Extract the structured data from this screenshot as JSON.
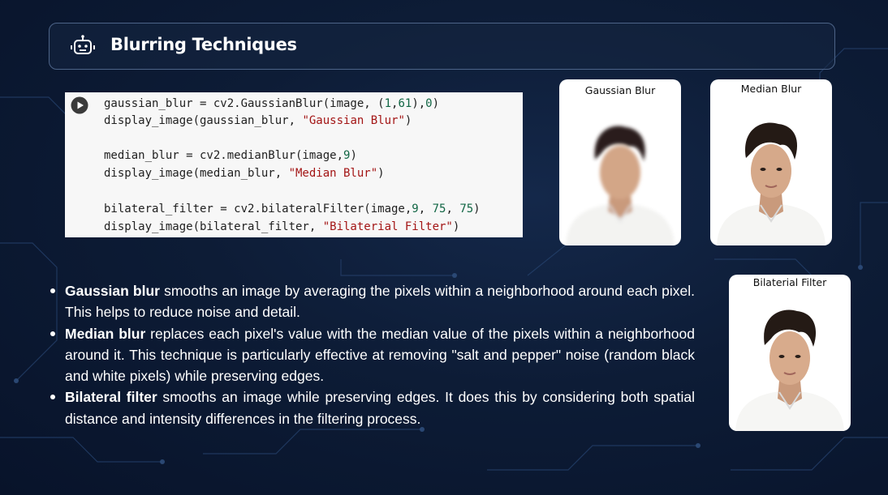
{
  "header": {
    "title": "Blurring Techniques",
    "icon": "robot-icon"
  },
  "code": {
    "lines": [
      {
        "plain1": "gaussian_blur = cv2.GaussianBlur(image, (",
        "num1": "1",
        "plain2": ",",
        "num2": "61",
        "plain3": "),",
        "num3": "0",
        "plain4": ")"
      },
      {
        "plain1": "display_image(gaussian_blur, ",
        "str": "\"Gaussian Blur\"",
        "plain2": ")"
      },
      {
        "plain1": "median_blur = cv2.medianBlur(image,",
        "num1": "9",
        "plain2": ")"
      },
      {
        "plain1": "display_image(median_blur, ",
        "str": "\"Median Blur\"",
        "plain2": ")"
      },
      {
        "plain1": "bilateral_filter = cv2.bilateralFilter(image,",
        "num1": "9",
        "plain2": ", ",
        "num2": "75",
        "plain3": ", ",
        "num3": "75",
        "plain4": ")"
      },
      {
        "plain1": "display_image(bilateral_filter, ",
        "str": "\"Bilaterial Filter\"",
        "plain2": ")"
      }
    ]
  },
  "images": {
    "gaussian": {
      "caption": "Gaussian Blur"
    },
    "median": {
      "caption": "Median Blur"
    },
    "bilateral": {
      "caption": "Bilaterial Filter"
    }
  },
  "bullets": [
    {
      "term": "Gaussian blur",
      "text": " smooths an image by averaging the pixels within a neighborhood around each pixel. This helps to reduce noise and detail."
    },
    {
      "term": "Median blur",
      "text": " replaces each pixel's value with the median value of the pixels within a neighborhood around it. This technique is particularly effective at removing \"salt and pepper\" noise (random black and white pixels) while preserving edges."
    },
    {
      "term": "Bilateral filter",
      "text": " smooths an image while preserving edges. It does this by considering both spatial distance and intensity differences in the filtering process."
    }
  ],
  "colors": {
    "background": "#0d1c36",
    "accent_border": "#4d6488",
    "code_string": "#a31515",
    "code_number": "#116644"
  }
}
